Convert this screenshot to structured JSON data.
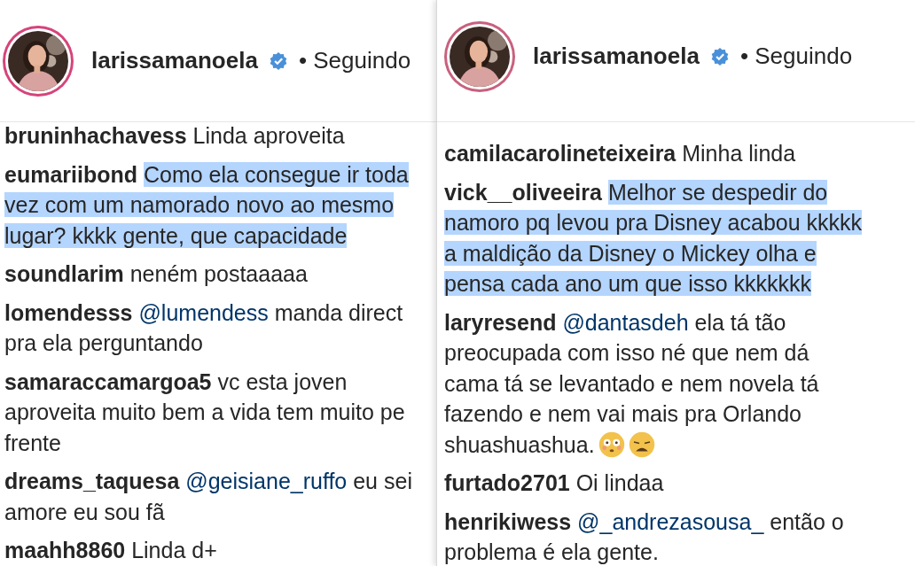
{
  "panels": [
    {
      "header": {
        "username": "larissamanoela",
        "verified": true,
        "status": "• Seguindo",
        "color": "#d6447a"
      },
      "comments": [
        {
          "user": "bruninhachavess",
          "text": "Linda aproveita",
          "selected": false
        },
        {
          "user": "eumariibond",
          "text": "Como ela consegue ir toda vez com um namorado novo ao mesmo lugar? kkkk gente, que capacidade",
          "selected": true
        },
        {
          "user": "soundlarim",
          "text": "neném postaaaaa",
          "selected": false
        },
        {
          "user": "lomendesss",
          "mention": "@lumendess",
          "text": "manda direct pra ela perguntando",
          "selected": false
        },
        {
          "user": "samaraccamargoa5",
          "text": "vc esta joven aproveita muito bem a vida tem muito pe frente",
          "selected": false
        },
        {
          "user": "dreams_taquesa",
          "mention": "@geisiane_ruffo",
          "text": "eu sei amore eu sou fã",
          "selected": false
        },
        {
          "user": "maahh8860",
          "text": "Linda d+",
          "selected": false
        }
      ]
    },
    {
      "header": {
        "username": "larissamanoela",
        "verified": true,
        "status": "• Seguindo",
        "color": "#c8607e"
      },
      "comments": [
        {
          "user": "camilacarolineteixeira",
          "text": "Minha linda",
          "selected": false
        },
        {
          "user": "vick__oliveeira",
          "text": "Melhor se despedir do namoro pq levou pra Disney acabou kkkkk a maldição da Disney o Mickey olha e pensa cada ano um que isso kkkkkkk",
          "selected": true
        },
        {
          "user": "laryresend",
          "mention": "@dantasdeh",
          "text": "ela tá tão preocupada com isso né que nem dá cama tá se levantado e nem novela tá fazendo e nem vai mais pra Orlando shuashuashua.",
          "emojis": [
            {
              "kind": "flushed"
            },
            {
              "kind": "weary"
            }
          ],
          "selected": false
        },
        {
          "user": "furtado2701",
          "text": "Oi lindaa",
          "selected": false
        },
        {
          "user": "henrikiwess",
          "mention": "@_andrezasousa_",
          "text": "então o problema é ela gente.",
          "selected": false
        }
      ]
    }
  ]
}
